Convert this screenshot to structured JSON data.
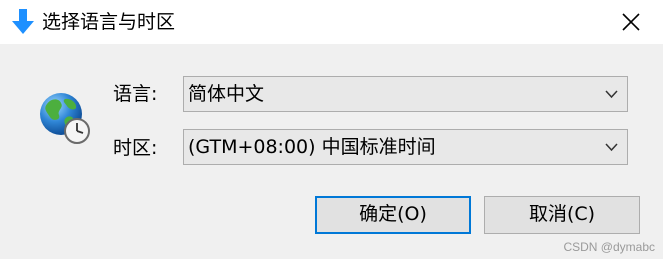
{
  "window": {
    "title": "选择语言与时区",
    "title_icon": "download-arrow-icon",
    "close_icon": "close-icon"
  },
  "form": {
    "icon": "globe-clock-icon",
    "language": {
      "label": "语言:",
      "value": "简体中文"
    },
    "timezone": {
      "label": "时区:",
      "value": "(GTM+08:00) 中国标准时间"
    }
  },
  "buttons": {
    "ok_label": "确定(O)",
    "cancel_label": "取消(C)"
  },
  "watermark": "CSDN @dymabc",
  "colors": {
    "accent": "#0078d7",
    "title_icon": "#1e90ff",
    "background": "#f0f0f0"
  }
}
